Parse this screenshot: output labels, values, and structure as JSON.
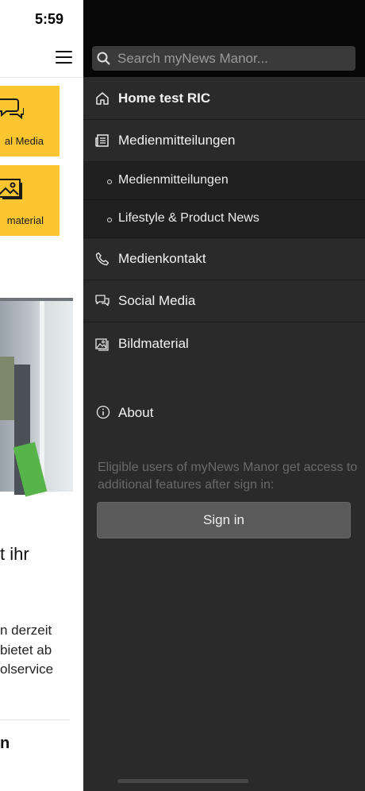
{
  "status_bar": {
    "time": "5:59"
  },
  "background_app": {
    "tiles": [
      {
        "label": "al Media",
        "icon": "social-media-icon"
      },
      {
        "label": "material",
        "icon": "picture-icon"
      }
    ],
    "snippet_title": "t ihr",
    "snippet_lines": [
      "n derzeit",
      "bietet ab",
      "olservice"
    ],
    "snippet_title2": "n"
  },
  "drawer": {
    "search": {
      "placeholder": "Search myNews Manor..."
    },
    "menu": [
      {
        "label": "Home test RIC",
        "icon": "home-icon"
      },
      {
        "label": "Medienmitteilungen",
        "icon": "newspaper-icon"
      }
    ],
    "submenu": [
      {
        "label": "Medienmitteilungen"
      },
      {
        "label": "Lifestyle & Product News"
      }
    ],
    "menu2": [
      {
        "label": "Medienkontakt",
        "icon": "phone-icon"
      },
      {
        "label": "Social Media",
        "icon": "chat-bubbles-icon"
      },
      {
        "label": "Bildmaterial",
        "icon": "image-icon"
      }
    ],
    "about": {
      "label": "About",
      "icon": "info-icon"
    },
    "signin_note": "Eligible users of myNews Manor get access to additional features after sign in:",
    "signin_button": "Sign in"
  },
  "colors": {
    "accent_tile": "#fdc530",
    "drawer_bg": "#2a2a2a",
    "drawer_top": "#070707"
  }
}
